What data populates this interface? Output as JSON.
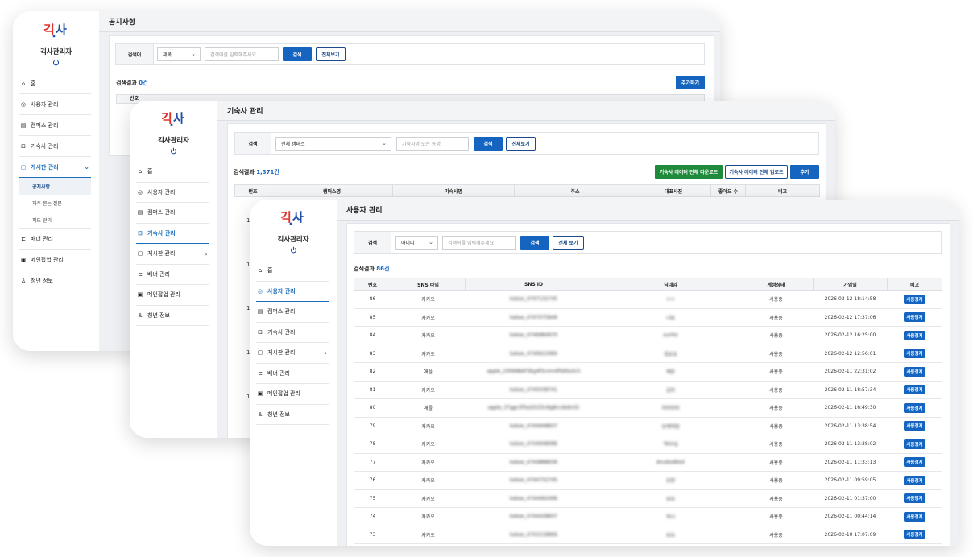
{
  "app": {
    "logo_text": "긱사",
    "admin_title": "긱사관리자"
  },
  "notice_window": {
    "title": "공지사항",
    "nav": [
      {
        "label": "홈",
        "icon": "home-icon"
      },
      {
        "label": "사용자 관리",
        "icon": "user-circle-icon"
      },
      {
        "label": "캠퍼스 관리",
        "icon": "building-icon"
      },
      {
        "label": "기숙사 관리",
        "icon": "bed-icon"
      },
      {
        "label": "게시판 관리",
        "icon": "clipboard-icon"
      },
      {
        "label": "배너 관리",
        "icon": "banner-icon"
      },
      {
        "label": "메인팝업 관리",
        "icon": "popup-icon"
      },
      {
        "label": "청년 정보",
        "icon": "person-icon"
      }
    ],
    "sub_nav": [
      "공지사항",
      "자주 묻는 질문",
      "피드 관리"
    ],
    "search": {
      "label": "검색어",
      "select_value": "제목",
      "placeholder": "검색어를 입력해주세요.",
      "search_button": "검색",
      "all_button": "전체보기"
    },
    "result": {
      "prefix": "검색결과 ",
      "count": "0건"
    },
    "add_button": "추가하기",
    "table_header_first": "번호"
  },
  "dorm_window": {
    "title": "기숙사 관리",
    "nav": [
      {
        "label": "홈",
        "icon": "home-icon"
      },
      {
        "label": "사용자 관리",
        "icon": "user-circle-icon"
      },
      {
        "label": "캠퍼스 관리",
        "icon": "building-icon"
      },
      {
        "label": "기숙사 관리",
        "icon": "bed-icon"
      },
      {
        "label": "게시판 관리",
        "icon": "clipboard-icon"
      },
      {
        "label": "배너 관리",
        "icon": "banner-icon"
      },
      {
        "label": "메인팝업 관리",
        "icon": "popup-icon"
      },
      {
        "label": "청년 정보",
        "icon": "person-icon"
      }
    ],
    "search": {
      "label": "검색",
      "select_value": "전체 캠퍼스",
      "placeholder": "기숙사명 또는 동명",
      "search_button": "검색",
      "all_button": "전체보기"
    },
    "result": {
      "prefix": "검색결과 ",
      "count": "1,371건"
    },
    "buttons": {
      "download": "기숙사 데이터 전체 다운로드",
      "upload": "기숙사 데이터 전체 업로드",
      "add": "추가"
    },
    "columns": [
      "번호",
      "캠퍼스명",
      "기숙사명",
      "주소",
      "대표사진",
      "좋아요 수",
      "비고"
    ],
    "row_numbers": [
      "1",
      "1",
      "1",
      "1",
      "1"
    ]
  },
  "user_window": {
    "title": "사용자 관리",
    "nav": [
      {
        "label": "홈",
        "icon": "home-icon"
      },
      {
        "label": "사용자 관리",
        "icon": "user-circle-icon"
      },
      {
        "label": "캠퍼스 관리",
        "icon": "building-icon"
      },
      {
        "label": "기숙사 관리",
        "icon": "bed-icon"
      },
      {
        "label": "게시판 관리",
        "icon": "clipboard-icon"
      },
      {
        "label": "배너 관리",
        "icon": "banner-icon"
      },
      {
        "label": "메인팝업 관리",
        "icon": "popup-icon"
      },
      {
        "label": "청년 정보",
        "icon": "person-icon"
      }
    ],
    "search": {
      "label": "검색",
      "select_value": "아이디",
      "placeholder": "검색어를 입력해주세요",
      "search_button": "검색",
      "all_button": "전체 보기"
    },
    "result": {
      "prefix": "검색결과 ",
      "count": "86건"
    },
    "columns": [
      "번호",
      "SNS 타입",
      "SNS ID",
      "닉네임",
      "계정상태",
      "가입일",
      "비고"
    ],
    "rows": [
      {
        "no": "86",
        "type": "카카오",
        "sns_id": "kakao_4747132745",
        "nick": "ㅇㅇ",
        "status": "사용중",
        "date": "2026-02-12 18:14:58",
        "action": "사용정지"
      },
      {
        "no": "85",
        "type": "카카오",
        "sns_id": "kakao_4747075849",
        "nick": "나동",
        "status": "사용중",
        "date": "2026-02-12 17:37:06",
        "action": "사용정지"
      },
      {
        "no": "84",
        "type": "카카오",
        "sns_id": "kakao_4746984970",
        "nick": "sunho",
        "status": "사용중",
        "date": "2026-02-12 16:25:00",
        "action": "사용정지"
      },
      {
        "no": "83",
        "type": "카카오",
        "sns_id": "kakao_4746622984",
        "nick": "정윤호",
        "status": "사용중",
        "date": "2026-02-12 12:56:01",
        "action": "사용정지"
      },
      {
        "no": "82",
        "type": "애플",
        "sns_id": "apple_23FA9B4F5Eg4f3cmn4f0d0a3c5",
        "nick": "해윤",
        "status": "사용중",
        "date": "2026-02-11 22:31:02",
        "action": "사용정지"
      },
      {
        "no": "81",
        "type": "카카오",
        "sns_id": "kakao_4745038741",
        "nick": "김하",
        "status": "사용중",
        "date": "2026-02-11 18:57:34",
        "action": "사용정지"
      },
      {
        "no": "80",
        "type": "애플",
        "sns_id": "apple_37ggc5f5e2D1f2c8g8ccde9c02",
        "nick": "하하하하",
        "status": "사용중",
        "date": "2026-02-11 16:49:30",
        "action": "사용정지"
      },
      {
        "no": "79",
        "type": "카카오",
        "sns_id": "kakao_4744948837",
        "nick": "유채하람",
        "status": "사용중",
        "date": "2026-02-11 13:38:54",
        "action": "사용정지"
      },
      {
        "no": "78",
        "type": "카카오",
        "sns_id": "kakao_4744948086",
        "nick": "Yeong",
        "status": "사용중",
        "date": "2026-02-11 13:38:02",
        "action": "사용정지"
      },
      {
        "no": "77",
        "type": "카카오",
        "sns_id": "kakao_4744888936",
        "nick": "AnubisWizd",
        "status": "사용중",
        "date": "2026-02-11 11:33:13",
        "action": "사용정지"
      },
      {
        "no": "76",
        "type": "카카오",
        "sns_id": "kakao_4744732745",
        "nick": "유현",
        "status": "사용중",
        "date": "2026-02-11 09:59:05",
        "action": "사용정지"
      },
      {
        "no": "75",
        "type": "카카오",
        "sns_id": "kakao_4744492496",
        "nick": "유유",
        "status": "사용중",
        "date": "2026-02-11 01:37:00",
        "action": "사용정지"
      },
      {
        "no": "74",
        "type": "카카오",
        "sns_id": "kakao_4744428837",
        "nick": "하나",
        "status": "사용중",
        "date": "2026-02-11 00:44:14",
        "action": "사용정지"
      },
      {
        "no": "73",
        "type": "카카오",
        "sns_id": "kakao_4743218866",
        "nick": "요요",
        "status": "사용중",
        "date": "2026-02-10 17:07:09",
        "action": "사용정지"
      }
    ]
  },
  "colors": {
    "primary": "#1565c0",
    "green": "#1f8a3b",
    "logo_red": "#e0312b",
    "logo_blue": "#1f4fa8"
  }
}
